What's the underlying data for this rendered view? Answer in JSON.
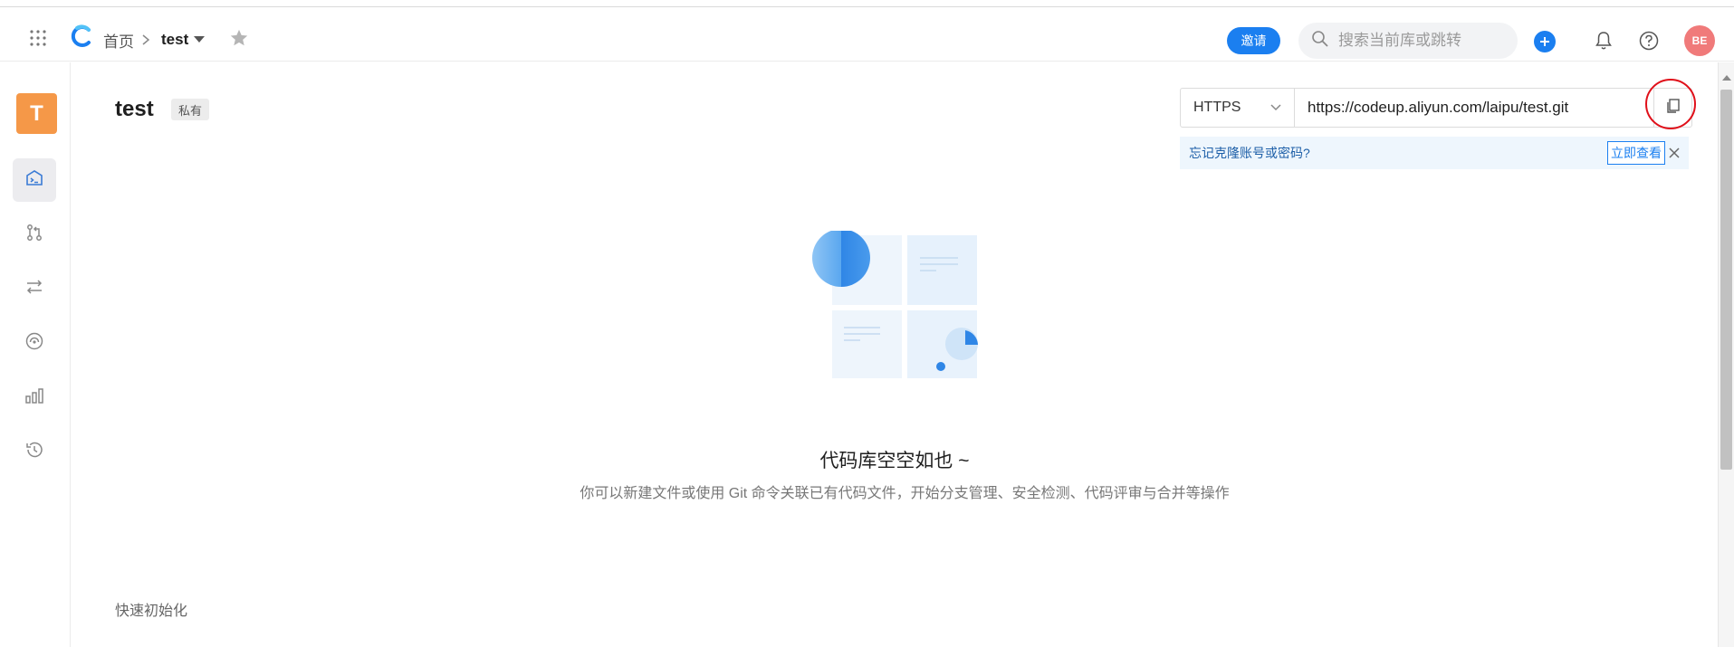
{
  "header": {
    "breadcrumb_home": "首页",
    "repo_name": "test",
    "invite_label": "邀请",
    "search_placeholder": "搜索当前库或跳转",
    "avatar_initials": "BE"
  },
  "sidebar": {
    "repo_initial": "T",
    "items": [
      {
        "name": "code-icon",
        "active": true
      },
      {
        "name": "merge-request-icon",
        "active": false
      },
      {
        "name": "branch-compare-icon",
        "active": false
      },
      {
        "name": "security-scan-icon",
        "active": false
      },
      {
        "name": "statistics-icon",
        "active": false
      },
      {
        "name": "history-icon",
        "active": false
      }
    ]
  },
  "main": {
    "title": "test",
    "visibility_tag": "私有",
    "clone": {
      "protocol": "HTTPS",
      "url": "https://codeup.aliyun.com/laipu/test.git"
    },
    "notice": {
      "text": "忘记克隆账号或密码?",
      "link": "立即查看"
    },
    "empty": {
      "title": "代码库空空如也 ~",
      "description": "你可以新建文件或使用 Git 命令关联已有代码文件，开始分支管理、安全检测、代码评审与合并等操作"
    },
    "quick_init": "快速初始化"
  },
  "colors": {
    "accent": "#1b7ff0",
    "avatar": "#f07a7a",
    "repo_avatar": "#f59848",
    "annotation": "#e0101a"
  }
}
